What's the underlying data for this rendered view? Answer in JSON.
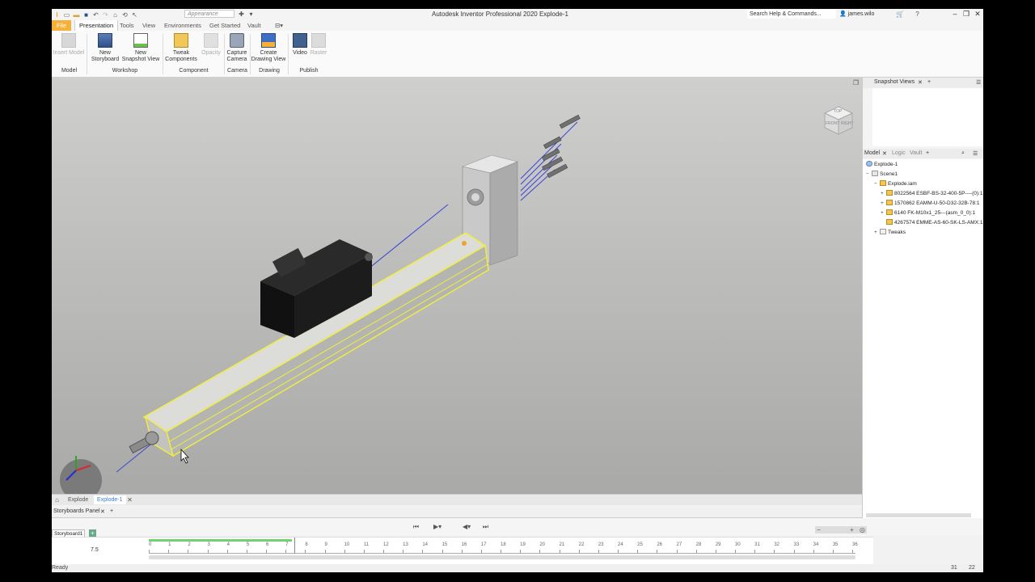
{
  "window": {
    "title": "Autodesk Inventor Professional 2020   Explode-1",
    "search_placeholder": "Search Help & Commands...",
    "user": "james.wilo",
    "appearance_placeholder": "Appearance"
  },
  "ribbon_tabs": [
    "File",
    "Presentation",
    "Tools",
    "View",
    "Environments",
    "Get Started",
    "Vault"
  ],
  "ribbon": {
    "insert_model": "Insert Model",
    "new_storyboard_1": "New",
    "new_storyboard_2": "Storyboard",
    "new_snapshot_1": "New",
    "new_snapshot_2": "Snapshot View",
    "tweak_1": "Tweak",
    "tweak_2": "Components",
    "opacity": "Opacity",
    "capture_1": "Capture",
    "capture_2": "Camera",
    "create_1": "Create",
    "create_2": "Drawing View",
    "video": "Video",
    "raster": "Raster",
    "panels": [
      "Model",
      "Workshop",
      "Component",
      "Camera",
      "Drawing",
      "Publish"
    ]
  },
  "viewcube": {
    "top": "TOP",
    "front": "FRONT",
    "right": "RIGHT"
  },
  "document_tabs": [
    "Explode",
    "Explode-1"
  ],
  "storyboard": {
    "panel_title": "Storyboards Panel",
    "tab": "Storyboard1",
    "current_time": "7.5",
    "ticks": [
      "0",
      "1",
      "2",
      "3",
      "4",
      "5",
      "6",
      "7",
      "8",
      "9",
      "10",
      "11",
      "12",
      "13",
      "14",
      "15",
      "16",
      "17",
      "18",
      "19",
      "20",
      "21",
      "22",
      "23",
      "24",
      "25",
      "26",
      "27",
      "28",
      "29",
      "30",
      "31",
      "32",
      "33",
      "34",
      "35",
      "36"
    ]
  },
  "snapshot_views": {
    "title": "Snapshot Views"
  },
  "browser": {
    "tabs": [
      "Model",
      "Logic",
      "Vault"
    ],
    "nodes": [
      "Explode-1",
      "Scene1",
      "Explode.iam",
      "8022564 ESBF-BS-32-400-5P----(0):1",
      "1570862 EAMM-U-50-D32-32B-78:1",
      "6140 FK-M10x1_25---(asm_0_0):1",
      "4267574 EMME-AS-60-SK-LS-AMX:1",
      "Tweaks"
    ]
  },
  "status": {
    "ready": "Ready",
    "num1": "31",
    "num2": "22"
  },
  "colors": {
    "file_tab": "#f6b13b",
    "selection": "#f2ef3a",
    "timeline_green": "#6fd36f",
    "accent": "#3b7fd4"
  }
}
